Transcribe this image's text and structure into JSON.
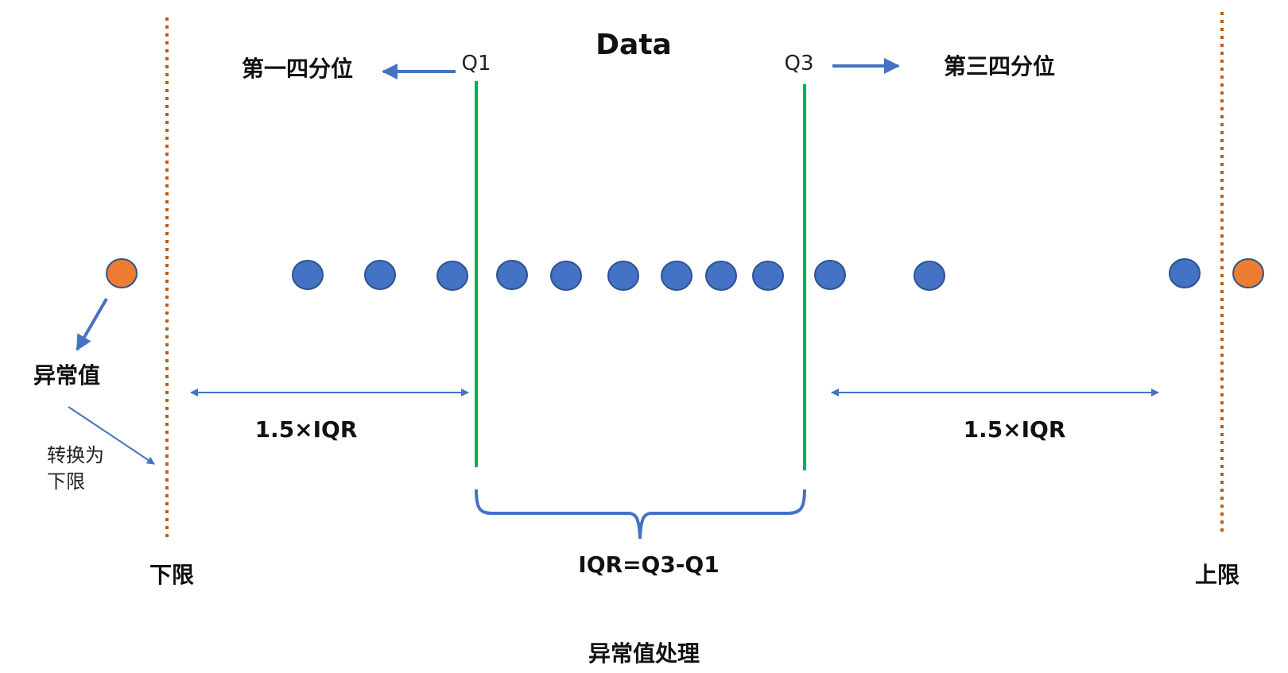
{
  "title": "Data",
  "q1_label": "Q1",
  "q3_label": "Q3",
  "first_quartile": "第一四分位",
  "third_quartile": "第三四分位",
  "outlier_label": "异常值",
  "convert_line1": "转换为",
  "convert_line2": "下限",
  "lower_span_label": "1.5×IQR",
  "upper_span_label": "1.5×IQR",
  "iqr_label": "IQR=Q3-Q1",
  "lower_limit": "下限",
  "upper_limit": "上限",
  "caption": "异常值处理",
  "colors": {
    "normal_point": "#4472C4",
    "outlier_point": "#ED7D31",
    "quartile_line": "#00B050",
    "limit_line": "#C55A11",
    "arrow": "#4472C4"
  },
  "points": [
    {
      "type": "outlier"
    },
    {
      "type": "normal"
    },
    {
      "type": "normal"
    },
    {
      "type": "normal"
    },
    {
      "type": "normal"
    },
    {
      "type": "normal"
    },
    {
      "type": "normal"
    },
    {
      "type": "normal"
    },
    {
      "type": "normal"
    },
    {
      "type": "normal"
    },
    {
      "type": "normal"
    },
    {
      "type": "normal"
    },
    {
      "type": "normal"
    },
    {
      "type": "outlier"
    }
  ]
}
